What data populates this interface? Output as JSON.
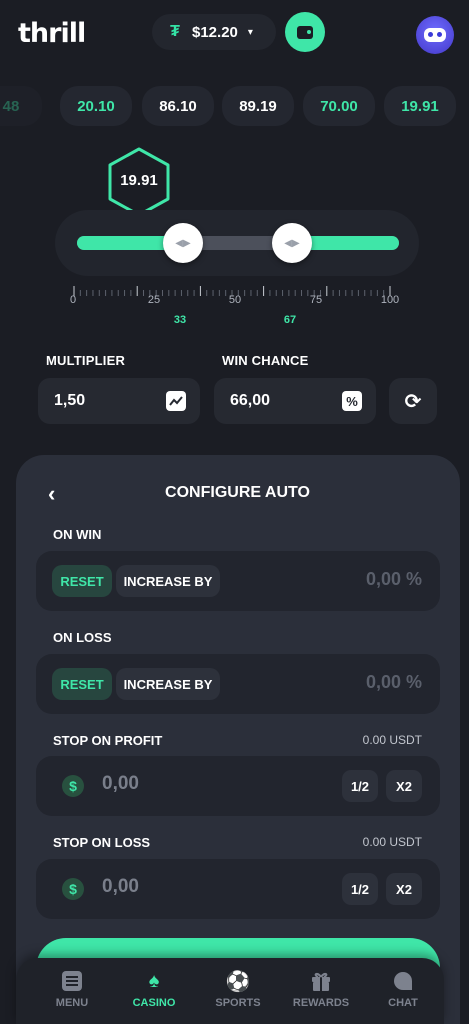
{
  "header": {
    "logo": "thrill",
    "currency_symbol": "₮",
    "balance": "$12.20",
    "caret": "▾"
  },
  "history": [
    "48",
    "20.10",
    "86.10",
    "89.19",
    "70.00",
    "19.91"
  ],
  "result_badge": "19.91",
  "slider": {
    "range_low": 33,
    "range_high": 67,
    "mark_low_label": "33",
    "mark_high_label": "67",
    "scale_labels": [
      "0",
      "25",
      "50",
      "75",
      "100"
    ]
  },
  "controls": {
    "multiplier_label": "MULTIPLIER",
    "multiplier_value": "1,50",
    "win_chance_label": "WIN CHANCE",
    "win_chance_value": "66,00",
    "percent_icon": "%"
  },
  "auto_panel": {
    "back": "‹",
    "title": "CONFIGURE AUTO",
    "on_win": {
      "label": "ON WIN",
      "reset": "RESET",
      "increase": "INCREASE BY",
      "value": "0,00 %"
    },
    "on_loss": {
      "label": "ON LOSS",
      "reset": "RESET",
      "increase": "INCREASE BY",
      "value": "0,00 %"
    },
    "stop_profit": {
      "label": "STOP ON PROFIT",
      "usdt": "0.00 USDT",
      "dollar": "$",
      "value": "0,00",
      "half": "1/2",
      "double": "X2"
    },
    "stop_loss": {
      "label": "STOP ON LOSS",
      "usdt": "0.00 USDT",
      "dollar": "$",
      "value": "0,00",
      "half": "1/2",
      "double": "X2"
    }
  },
  "nav": {
    "menu": "MENU",
    "casino": "CASINO",
    "sports": "SPORTS",
    "rewards": "REWARDS",
    "chat": "CHAT",
    "active": "casino"
  },
  "colors": {
    "accent": "#3fe6a8",
    "background": "#1b1d24",
    "panel": "#2b2f3a"
  }
}
